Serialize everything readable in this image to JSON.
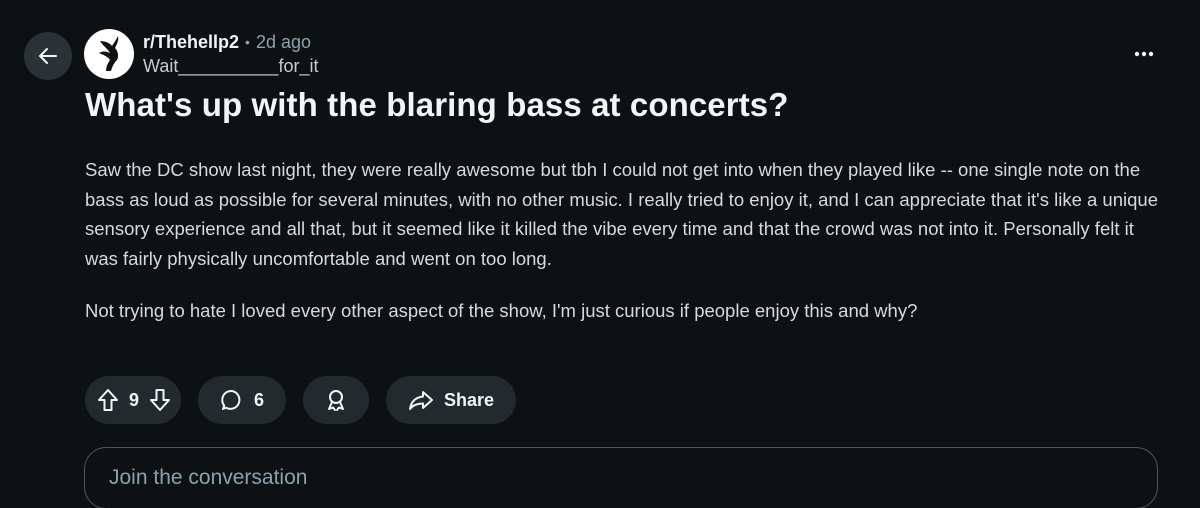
{
  "header": {
    "subreddit": "r/Thehellp2",
    "separator": "•",
    "time_ago": "2d ago",
    "username": "Wait__________for_it"
  },
  "post": {
    "title": "What's up with the blaring bass at concerts?",
    "paragraphs": [
      "Saw the DC show last night, they were really awesome but tbh I could not get into when they played like -- one single note on the bass as loud as possible for several minutes, with no other music. I really tried to enjoy it, and I can appreciate that it's like a unique sensory experience and all that, but it seemed like it killed the vibe every time and that the crowd was not into it. Personally felt it was fairly physically uncomfortable and went on too long.",
      "Not trying to hate I loved every other aspect of the show, I'm just curious if people enjoy this and why?"
    ]
  },
  "actions": {
    "vote_count": "9",
    "comment_count": "6",
    "share_label": "Share"
  },
  "composer": {
    "placeholder": "Join the conversation"
  },
  "icons": {
    "back": "arrow-left-icon",
    "more": "more-options-icon",
    "upvote": "upvote-icon",
    "downvote": "downvote-icon",
    "comment": "comment-icon",
    "award": "award-icon",
    "share": "share-icon"
  }
}
